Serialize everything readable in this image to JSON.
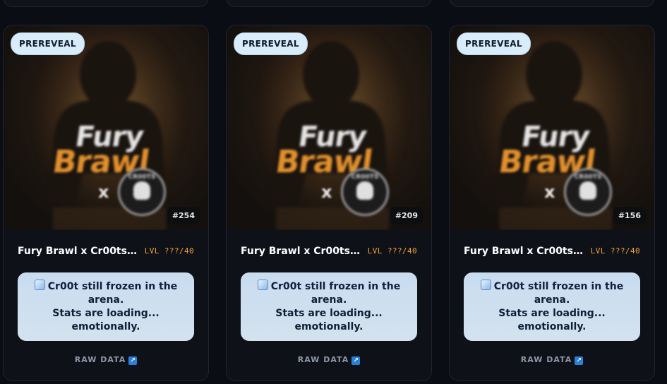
{
  "cards": [
    {
      "badge": "PREREVEAL",
      "token_id": "#254",
      "title": "Fury Brawl x Cr00ts...",
      "level": "LVL ???/40",
      "status": {
        "line1": "Cr00t still frozen in the",
        "line2": "arena.",
        "line3": "Stats are loading...",
        "line4": "emotionally."
      },
      "raw_label": "RAW DATA",
      "art": {
        "word1": "Fury",
        "word2": "Brawl",
        "x": "x",
        "badge_text": "CR00TS"
      }
    },
    {
      "badge": "PREREVEAL",
      "token_id": "#209",
      "title": "Fury Brawl x Cr00ts...",
      "level": "LVL ???/40",
      "status": {
        "line1": "Cr00t still frozen in the",
        "line2": "arena.",
        "line3": "Stats are loading...",
        "line4": "emotionally."
      },
      "raw_label": "RAW DATA",
      "art": {
        "word1": "Fury",
        "word2": "Brawl",
        "x": "x",
        "badge_text": "CR00TS"
      }
    },
    {
      "badge": "PREREVEAL",
      "token_id": "#156",
      "title": "Fury Brawl x Cr00ts...",
      "level": "LVL ???/40",
      "status": {
        "line1": "Cr00t still frozen in the",
        "line2": "arena.",
        "line3": "Stats are loading...",
        "line4": "emotionally."
      },
      "raw_label": "RAW DATA",
      "art": {
        "word1": "Fury",
        "word2": "Brawl",
        "x": "x",
        "badge_text": "CR00TS"
      }
    }
  ],
  "icons": {
    "status": "ice-cube-icon",
    "raw_link": "external-link-arrow-icon"
  },
  "colors": {
    "background": "#0b0d14",
    "badge_bg": "#d9ecfa",
    "level": "#f0a030",
    "status_bg": "#c9dcf0",
    "link_icon": "#2a7fd8"
  }
}
